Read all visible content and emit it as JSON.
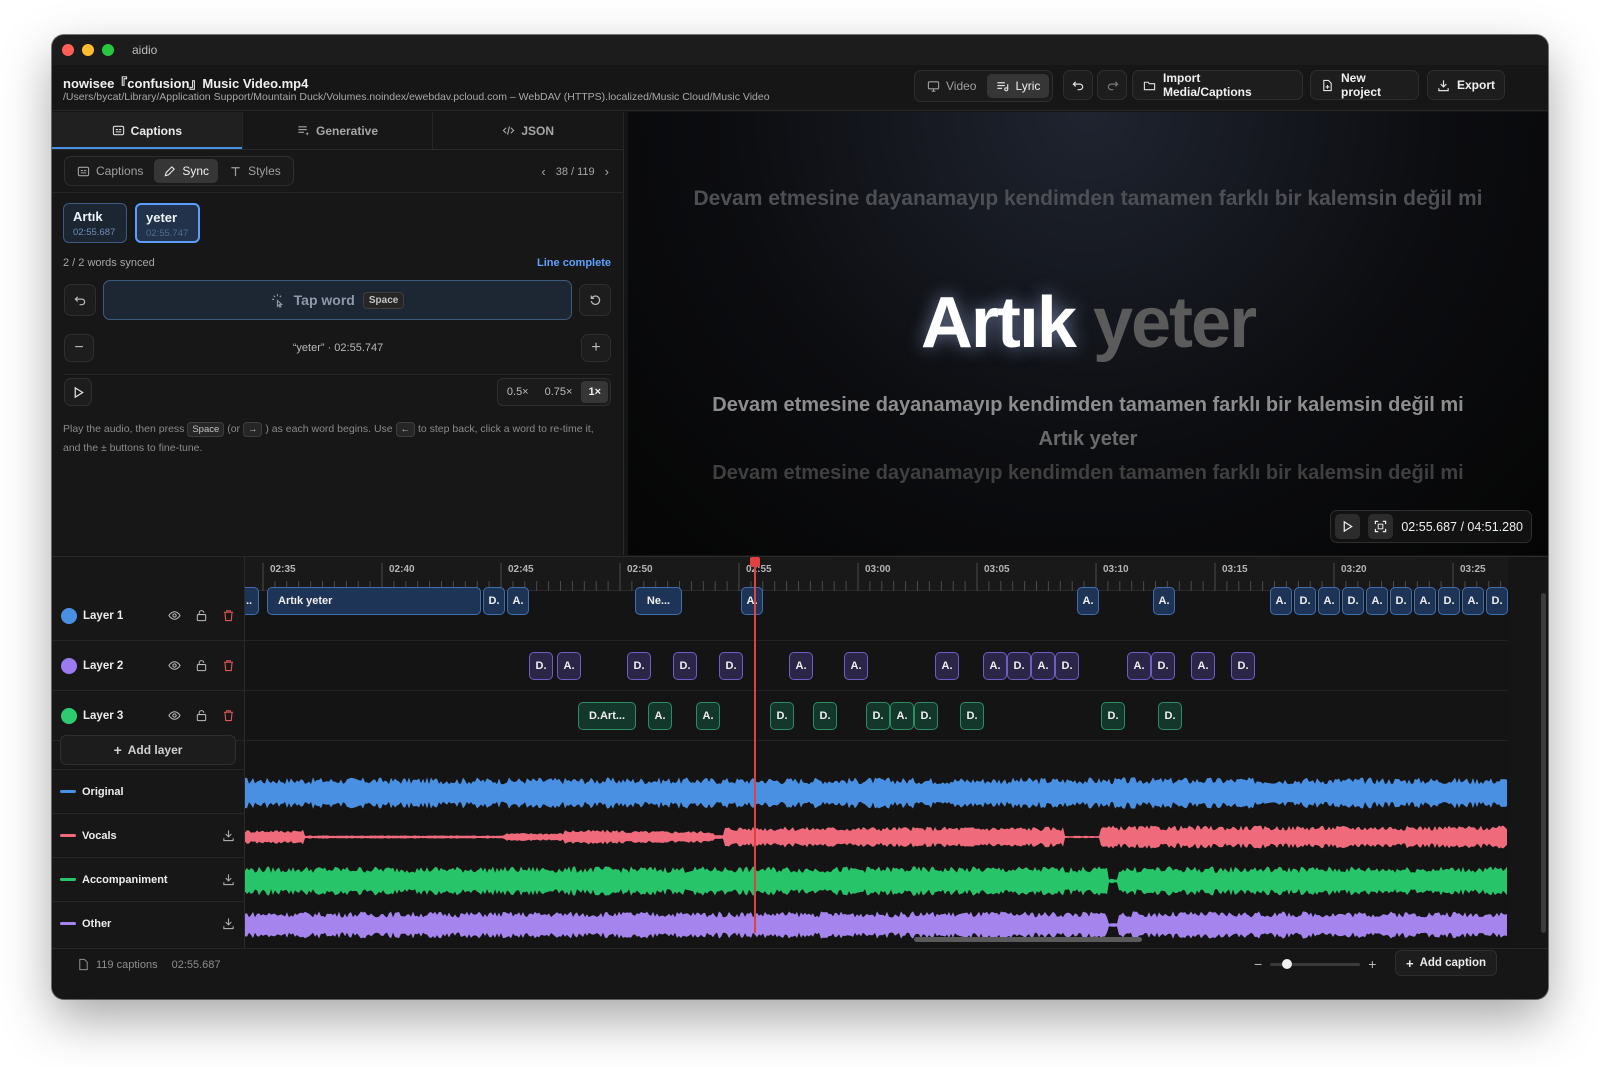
{
  "app": {
    "name": "aidio"
  },
  "file": {
    "name": "nowisee『confusion』Music Video.mp4",
    "path": "/Users/bycat/Library/Application Support/Mountain Duck/Volumes.noindex/ewebdav.pcloud.com – WebDAV (HTTPS).localized/Music Cloud/Music Video"
  },
  "view_toggle": {
    "video": "Video",
    "lyric": "Lyric",
    "selected": "Lyric"
  },
  "toolbar": {
    "import": "Import Media/Captions",
    "new_project": "New project",
    "export": "Export"
  },
  "tabs": {
    "captions": "Captions",
    "generative": "Generative",
    "json": "JSON",
    "selected": "Captions"
  },
  "subtabs": {
    "captions": "Captions",
    "sync": "Sync",
    "styles": "Styles",
    "selected": "Sync"
  },
  "pager": {
    "text": "38 / 119"
  },
  "words": [
    {
      "word": "Artık",
      "time": "02:55.687"
    },
    {
      "word": "yeter",
      "time": "02:55.747"
    }
  ],
  "sync_status": {
    "count": "2 / 2 words synced",
    "state": "Line complete"
  },
  "tap": {
    "label": "Tap word",
    "key": "Space"
  },
  "current_word": "“yeter” · 02:55.747",
  "speeds": [
    "0.5×",
    "0.75×",
    "1×"
  ],
  "speed_selected": "1×",
  "help": {
    "p1": "Play the audio, then press",
    "k1": "Space",
    "p2": "(or",
    "k2": "→",
    "p3": ") as each word begins. Use",
    "k3": "←",
    "p4": "to step back, click a word to re-time it, and the ± buttons to fine-tune."
  },
  "preview": {
    "prev_line": "Devam etmesine dayanamayıp kendimden tamamen farklı bir kalemsin değil mi",
    "current_a": "Artık",
    "current_b": "yeter",
    "next_lines": [
      "Devam etmesine dayanamayıp kendimden tamamen farklı bir kalemsin değil mi",
      "Artık yeter",
      "Devam etmesine dayanamayıp kendimden tamamen farklı bir kalemsin değil mi"
    ],
    "timecode": "02:55.687 / 04:51.280"
  },
  "ruler_labels": [
    "02:35",
    "02:40",
    "02:45",
    "02:50",
    "02:55",
    "03:00",
    "03:05",
    "03:10",
    "03:15",
    "03:20",
    "03:25"
  ],
  "layers": [
    {
      "name": "Layer 1",
      "color": "#4a90e2"
    },
    {
      "name": "Layer 2",
      "color": "#9b7bf0"
    },
    {
      "name": "Layer 3",
      "color": "#2ecc71"
    }
  ],
  "add_layer": "Add layer",
  "audio_tracks": [
    {
      "name": "Original",
      "color": "#4a90e2"
    },
    {
      "name": "Vocals",
      "color": "#ef6b7b"
    },
    {
      "name": "Accompaniment",
      "color": "#27c46a"
    },
    {
      "name": "Other",
      "color": "#a684ee"
    }
  ],
  "clips": {
    "layer1": [
      "Artık yeter",
      "D.",
      "A.",
      "Ne...",
      "A.",
      "A.",
      "A.",
      "A.",
      "D.",
      "A.",
      "D.",
      "A.",
      "D.",
      "A.",
      "D.",
      "A.",
      "D."
    ],
    "layer2": [
      "D.",
      "A.",
      "D.",
      "D.",
      "D.",
      "A.",
      "A.",
      "A.",
      "A.",
      "D.",
      "A.",
      "D.",
      "A.",
      "D.",
      "A.",
      "D."
    ],
    "layer3": [
      "D.Art...",
      "A.",
      "A.",
      "D.",
      "D.",
      "D.",
      "A.",
      "D.",
      "D.",
      "D.",
      "D."
    ]
  },
  "status": {
    "captions": "119 captions",
    "time": "02:55.687",
    "add_caption": "Add caption"
  }
}
